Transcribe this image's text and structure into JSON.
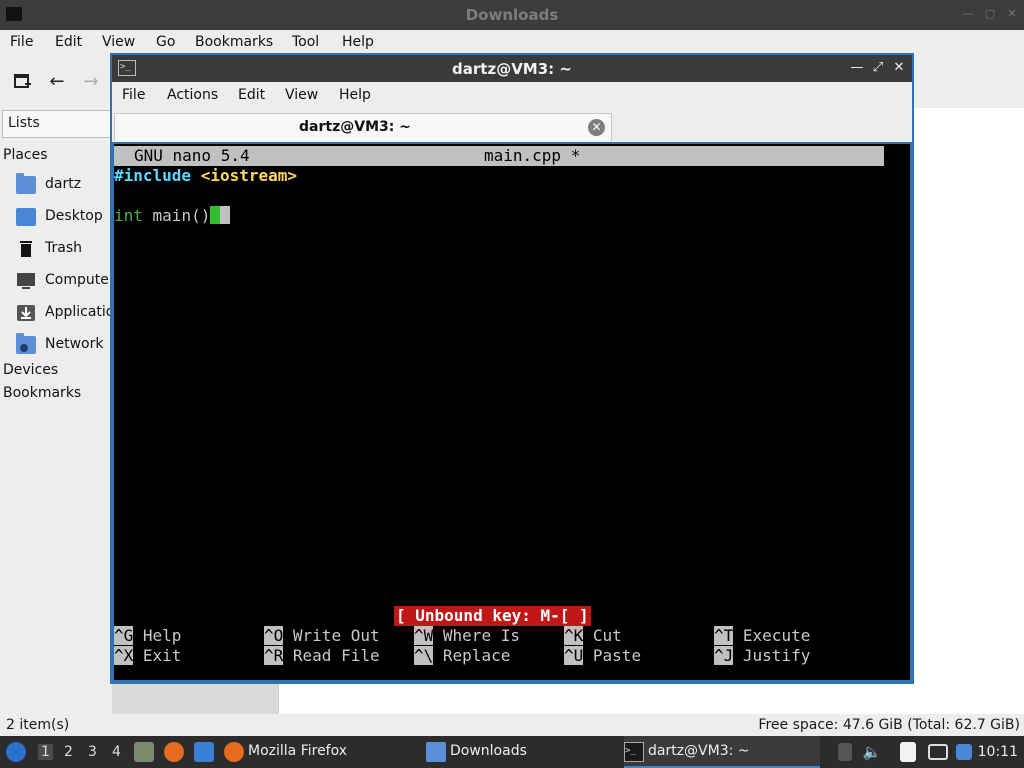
{
  "file_manager": {
    "title": "Downloads",
    "menu": [
      "File",
      "Edit",
      "View",
      "Go",
      "Bookmarks",
      "Tool",
      "Help"
    ],
    "sidebar_mode": "Lists",
    "places_heading": "Places",
    "places": [
      {
        "label": "dartz",
        "icon": "home-folder-icon"
      },
      {
        "label": "Desktop",
        "icon": "desktop-icon"
      },
      {
        "label": "Trash",
        "icon": "trash-icon"
      },
      {
        "label": "Computer",
        "icon": "computer-icon"
      },
      {
        "label": "Applications",
        "icon": "applications-icon"
      },
      {
        "label": "Network",
        "icon": "network-icon"
      }
    ],
    "devices_heading": "Devices",
    "bookmarks_heading": "Bookmarks",
    "status_left": "2 item(s)",
    "status_right": "Free space: 47.6 GiB (Total: 62.7 GiB)"
  },
  "terminal": {
    "title": "dartz@VM3: ~",
    "menu": [
      "File",
      "Actions",
      "Edit",
      "View",
      "Help"
    ],
    "tab_label": "dartz@VM3: ~",
    "nano": {
      "version": "GNU nano 5.4",
      "filename": "main.cpp *",
      "line1_directive": "#include",
      "line1_header": "<iostream>",
      "line3_keyword": "int",
      "line3_rest": " main()",
      "status_message": "[ Unbound key: M-[ ]",
      "shortcuts": [
        {
          "key": "^G",
          "label": "Help"
        },
        {
          "key": "^O",
          "label": "Write Out"
        },
        {
          "key": "^W",
          "label": "Where Is"
        },
        {
          "key": "^K",
          "label": "Cut"
        },
        {
          "key": "^T",
          "label": "Execute"
        },
        {
          "key": "^X",
          "label": "Exit"
        },
        {
          "key": "^R",
          "label": "Read File"
        },
        {
          "key": "^\\",
          "label": "Replace"
        },
        {
          "key": "^U",
          "label": "Paste"
        },
        {
          "key": "^J",
          "label": "Justify"
        }
      ]
    }
  },
  "taskbar": {
    "workspaces": [
      "1",
      "2",
      "3",
      "4"
    ],
    "active_workspace": "1",
    "tasks": [
      {
        "label": "Mozilla Firefox",
        "icon": "firefox-icon"
      },
      {
        "label": "Downloads",
        "icon": "folder-icon"
      },
      {
        "label": "dartz@VM3: ~",
        "icon": "terminal-icon"
      }
    ],
    "clock": "10:11"
  }
}
